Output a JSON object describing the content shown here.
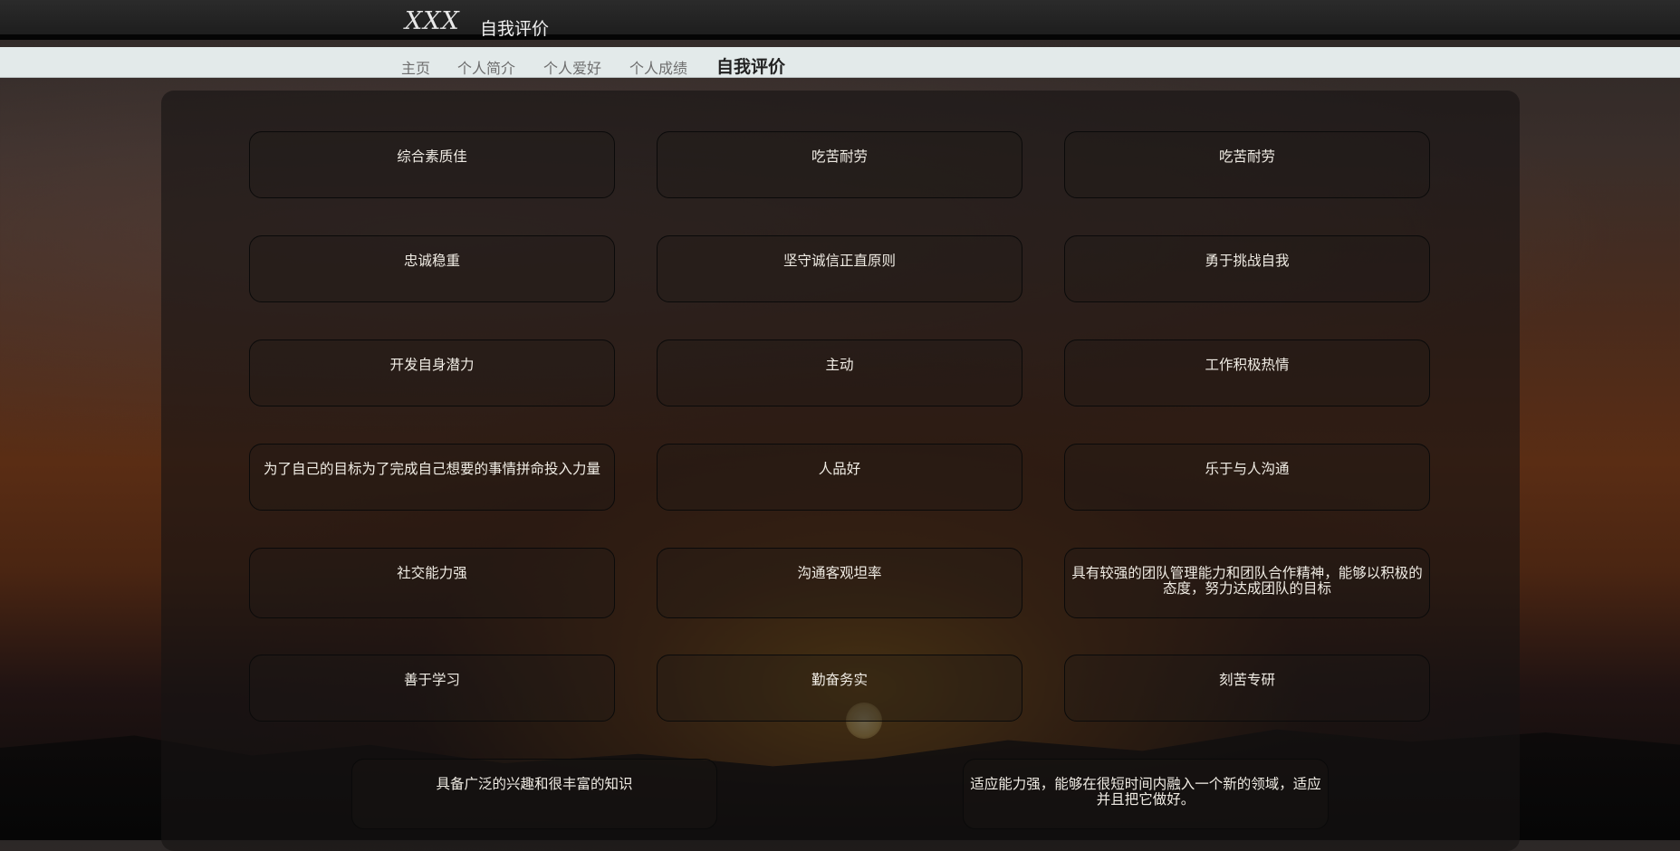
{
  "header": {
    "logo": "XXX",
    "title": "自我评价"
  },
  "nav": {
    "items": [
      {
        "label": "主页"
      },
      {
        "label": "个人简介"
      },
      {
        "label": "个人爱好"
      },
      {
        "label": "个人成绩"
      },
      {
        "label": "自我评价"
      }
    ],
    "active": "自我评价"
  },
  "evaluations": [
    {
      "text": "综合素质佳"
    },
    {
      "text": "吃苦耐劳"
    },
    {
      "text": "吃苦耐劳"
    },
    {
      "text": "忠诚稳重"
    },
    {
      "text": "坚守诚信正直原则"
    },
    {
      "text": "勇于挑战自我"
    },
    {
      "text": "开发自身潜力"
    },
    {
      "text": "主动"
    },
    {
      "text": "工作积极热情"
    },
    {
      "text": "为了自己的目标为了完成自己想要的事情拼命投入力量"
    },
    {
      "text": "人品好"
    },
    {
      "text": "乐于与人沟通"
    },
    {
      "text": "社交能力强"
    },
    {
      "text": "沟通客观坦率"
    },
    {
      "text": "具有较强的团队管理能力和团队合作精神，能够以积极的态度，努力达成团队的目标"
    },
    {
      "text": "善于学习"
    },
    {
      "text": "勤奋务实"
    },
    {
      "text": "刻苦专研"
    },
    {
      "text": "具备广泛的兴趣和很丰富的知识"
    },
    {
      "text": "适应能力强，能够在很短时间内融入一个新的领域，适应并且把它做好。"
    }
  ]
}
